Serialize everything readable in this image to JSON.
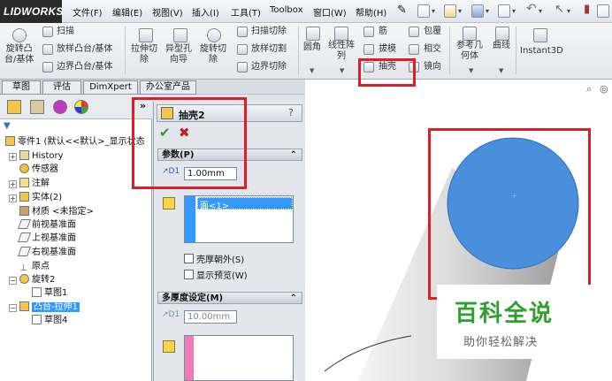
{
  "app": {
    "logo_text": "LIDWORKS"
  },
  "menu": [
    "文件(F)",
    "编辑(E)",
    "视图(V)",
    "插入(I)",
    "工具(T)",
    "Toolbox",
    "窗口(W)",
    "帮助(H)"
  ],
  "ribbon": {
    "revolve_boss": "旋转凸\n台/基体",
    "sweep": "扫描",
    "loft_boss": "放样凸台/基体",
    "boundary_boss": "边界凸台/基体",
    "extruded_cut": "拉伸切\n除",
    "hole_wizard": "异型孔\n向导",
    "revolved_cut": "旋转切\n除",
    "swept_cut": "扫描切除",
    "lofted_cut": "放样切割",
    "boundary_cut": "边界切除",
    "fillet": "圆角",
    "linear_pattern": "线性阵\n列",
    "rib": "筋",
    "draft": "拔模",
    "shell": "抽壳",
    "wrap": "包覆",
    "intersect": "相交",
    "mirror": "镜向",
    "ref_geometry": "参考几\n何体",
    "curves": "曲线",
    "instant3d": "Instant3D"
  },
  "tabs": [
    "草图",
    "评估",
    "DimXpert",
    "办公室产品"
  ],
  "tree": {
    "root": "零件1 (默认<<默认>_显示状态",
    "items": [
      {
        "label": "History"
      },
      {
        "label": "传感器"
      },
      {
        "label": "注解"
      },
      {
        "label": "实体(2)"
      },
      {
        "label": "材质 <未指定>"
      },
      {
        "label": "前视基准面"
      },
      {
        "label": "上视基准面"
      },
      {
        "label": "右视基准面"
      },
      {
        "label": "原点"
      },
      {
        "label": "旋转2"
      },
      {
        "label": "草图1"
      },
      {
        "label": "凸台-拉伸1"
      },
      {
        "label": "草图4"
      }
    ]
  },
  "property_manager": {
    "title": "抽壳2",
    "help": "?",
    "params_header": "参数(P)",
    "thickness_value": "1.00mm",
    "faces_list": [
      "面<1>"
    ],
    "shell_outward": "壳厚朝外(S)",
    "show_preview": "显示预览(W)",
    "multi_header": "多厚度设定(M)",
    "multi_thickness_value": "10.00mm"
  },
  "watermark": {
    "title": "百科全说",
    "subtitle": "助你轻松解决"
  },
  "colors": {
    "face_blue": "#4a8fdc",
    "annotation_red": "#e01c24",
    "selection_blue": "#3399ff"
  }
}
